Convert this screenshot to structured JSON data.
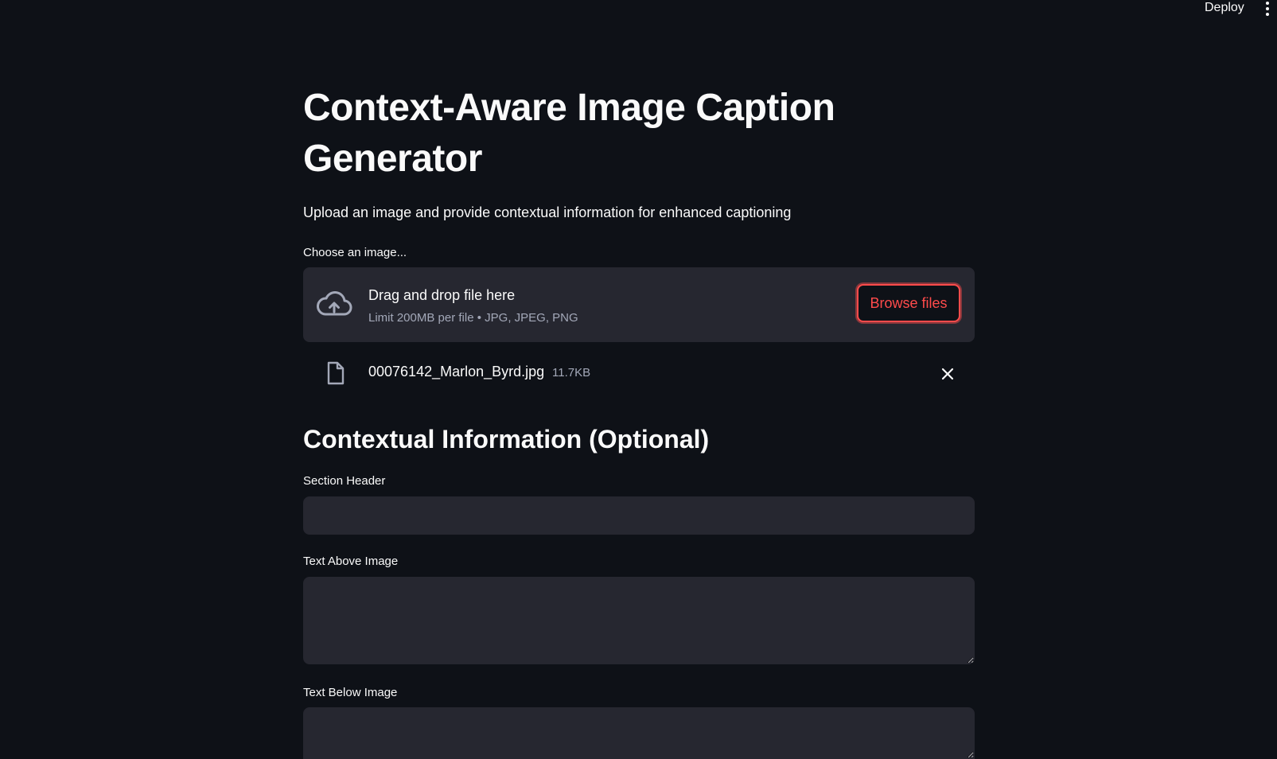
{
  "header": {
    "deploy_label": "Deploy",
    "menu_icon": "kebab-menu-icon"
  },
  "main": {
    "title": "Context-Aware Image Caption Generator",
    "subtitle": "Upload an image and provide contextual information for enhanced captioning"
  },
  "uploader": {
    "label": "Choose an image...",
    "drop_title": "Drag and drop file here",
    "drop_subtitle": "Limit 200MB per file • JPG, JPEG, PNG",
    "browse_label": "Browse files",
    "upload_icon": "cloud-upload-icon",
    "accent_color": "#ff4b4b"
  },
  "uploaded_file": {
    "name": "00076142_Marlon_Byrd.jpg",
    "size": "11.7KB",
    "file_icon": "file-icon",
    "remove_icon": "close-icon"
  },
  "context": {
    "heading": "Contextual Information (Optional)",
    "section_header": {
      "label": "Section Header",
      "value": ""
    },
    "text_above": {
      "label": "Text Above Image",
      "value": ""
    },
    "text_below": {
      "label": "Text Below Image",
      "value": ""
    }
  }
}
